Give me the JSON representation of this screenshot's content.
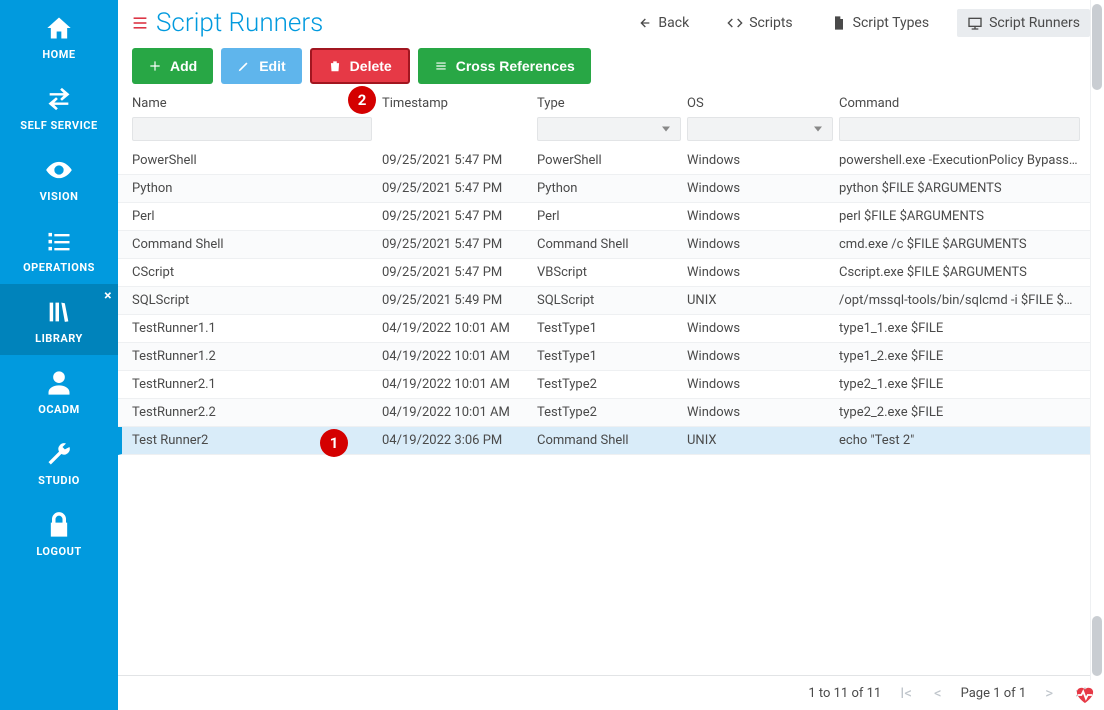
{
  "sidebar": {
    "items": [
      {
        "label": "HOME"
      },
      {
        "label": "SELF SERVICE"
      },
      {
        "label": "VISION"
      },
      {
        "label": "OPERATIONS"
      },
      {
        "label": "LIBRARY"
      },
      {
        "label": "OCADM"
      },
      {
        "label": "STUDIO"
      },
      {
        "label": "LOGOUT"
      }
    ]
  },
  "header": {
    "title": "Script Runners",
    "nav": {
      "back": "Back",
      "scripts": "Scripts",
      "script_types": "Script Types",
      "script_runners": "Script Runners"
    }
  },
  "toolbar": {
    "add": "Add",
    "edit": "Edit",
    "delete": "Delete",
    "cross_refs": "Cross References"
  },
  "grid": {
    "columns": {
      "name": "Name",
      "timestamp": "Timestamp",
      "type": "Type",
      "os": "OS",
      "command": "Command"
    },
    "rows": [
      {
        "name": "PowerShell",
        "timestamp": "09/25/2021 5:47 PM",
        "type": "PowerShell",
        "os": "Windows",
        "command": "powershell.exe -ExecutionPolicy Bypass -F..."
      },
      {
        "name": "Python",
        "timestamp": "09/25/2021 5:47 PM",
        "type": "Python",
        "os": "Windows",
        "command": "python $FILE $ARGUMENTS"
      },
      {
        "name": "Perl",
        "timestamp": "09/25/2021 5:47 PM",
        "type": "Perl",
        "os": "Windows",
        "command": "perl $FILE $ARGUMENTS"
      },
      {
        "name": "Command Shell",
        "timestamp": "09/25/2021 5:47 PM",
        "type": "Command Shell",
        "os": "Windows",
        "command": "cmd.exe /c $FILE $ARGUMENTS"
      },
      {
        "name": "CScript",
        "timestamp": "09/25/2021 5:47 PM",
        "type": "VBScript",
        "os": "Windows",
        "command": "Cscript.exe $FILE $ARGUMENTS"
      },
      {
        "name": "SQLScript",
        "timestamp": "09/25/2021 5:49 PM",
        "type": "SQLScript",
        "os": "UNIX",
        "command": "/opt/mssql-tools/bin/sqlcmd -i $FILE $AR..."
      },
      {
        "name": "TestRunner1.1",
        "timestamp": "04/19/2022 10:01 AM",
        "type": "TestType1",
        "os": "Windows",
        "command": "type1_1.exe $FILE"
      },
      {
        "name": "TestRunner1.2",
        "timestamp": "04/19/2022 10:01 AM",
        "type": "TestType1",
        "os": "Windows",
        "command": "type1_2.exe $FILE"
      },
      {
        "name": "TestRunner2.1",
        "timestamp": "04/19/2022 10:01 AM",
        "type": "TestType2",
        "os": "Windows",
        "command": "type2_1.exe $FILE"
      },
      {
        "name": "TestRunner2.2",
        "timestamp": "04/19/2022 10:01 AM",
        "type": "TestType2",
        "os": "Windows",
        "command": "type2_2.exe $FILE"
      },
      {
        "name": "Test Runner2",
        "timestamp": "04/19/2022 3:06 PM",
        "type": "Command Shell",
        "os": "UNIX",
        "command": "echo \"Test 2\""
      }
    ]
  },
  "pager": {
    "summary": "1 to 11 of 11",
    "page_label": "Page 1 of 1"
  },
  "annotations": {
    "one": "1",
    "two": "2"
  }
}
